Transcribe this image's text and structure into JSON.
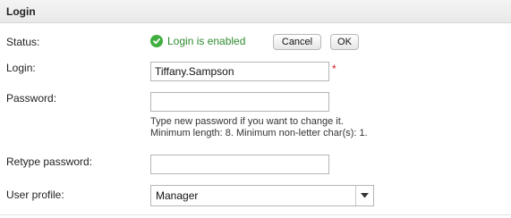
{
  "header": {
    "title": "Login"
  },
  "status": {
    "label": "Status:",
    "text": "Login is enabled",
    "icon": "check-circle-icon",
    "cancel_label": "Cancel",
    "ok_label": "OK"
  },
  "login": {
    "label": "Login:",
    "value": "Tiffany.Sampson",
    "required_mark": "*"
  },
  "password": {
    "label": "Password:",
    "value": "",
    "hint_line1": "Type new password if you want to change it.",
    "hint_line2": "Minimum length: 8. Minimum non-letter char(s): 1."
  },
  "retype_password": {
    "label": "Retype password:",
    "value": ""
  },
  "user_profile": {
    "label": "User profile:",
    "selected": "Manager"
  },
  "colors": {
    "accent_green": "#3fae3f",
    "status_text": "#2e8a2e",
    "required_red": "#d21d1d"
  }
}
